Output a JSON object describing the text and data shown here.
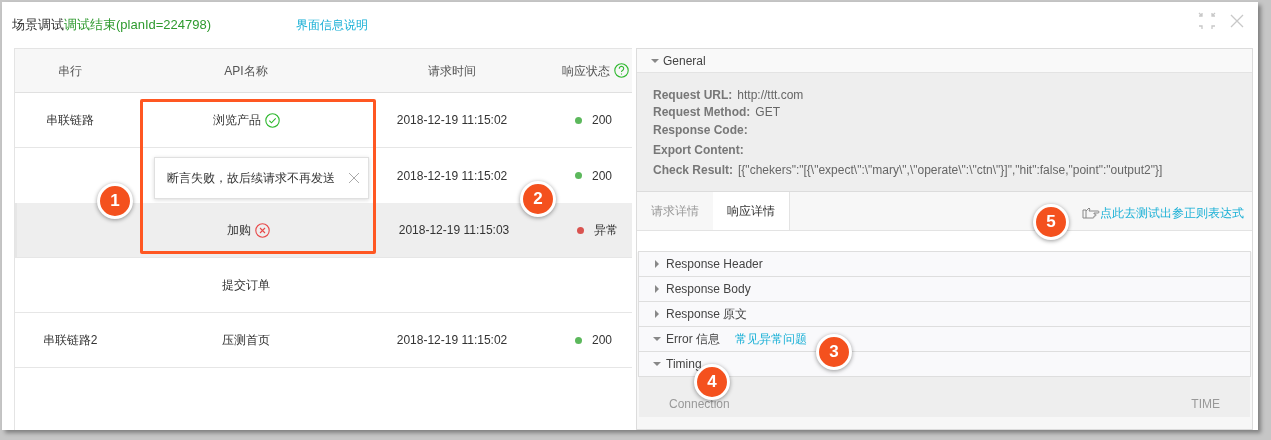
{
  "window": {
    "title": "场景调试",
    "run_status": "调试结束(planId=224798)",
    "info_link": "界面信息说明"
  },
  "table": {
    "columns": [
      "串行",
      "API名称",
      "请求时间",
      "响应状态"
    ],
    "rows": [
      {
        "chain": "串联链路",
        "api": "浏览产品",
        "passed": true,
        "time": "2018-12-19 11:15:02",
        "status": "200",
        "color": "#5cb85c",
        "selected": false
      },
      {
        "chain": "",
        "api": "",
        "time": "2018-12-19 11:15:02",
        "status": "200",
        "color": "#5cb85c",
        "selected": false
      },
      {
        "chain": "",
        "api": "加购",
        "passed": false,
        "time": "2018-12-19 11:15:03",
        "status": "异常",
        "color": "#d9534f",
        "selected": true
      },
      {
        "chain": "",
        "api": "提交订单",
        "time": "",
        "status": "",
        "color": "",
        "selected": false
      },
      {
        "chain": "串联链路2",
        "api": "压测首页",
        "time": "2018-12-19 11:15:02",
        "status": "200",
        "color": "#5cb85c",
        "selected": false
      }
    ]
  },
  "tooltip": {
    "text": "断言失败，故后续请求不再发送"
  },
  "general": {
    "title": "General",
    "expanded": true,
    "fields": [
      {
        "label": "Request URL:",
        "value": "http://ttt.com"
      },
      {
        "label": "Request Method:",
        "value": "GET"
      },
      {
        "label": "Response Code:"
      },
      {
        "label": "Export Content:"
      },
      {
        "label": "Check Result:",
        "value": "[{\"chekers\":\"[{\\\"expect\\\":\\\"mary\\\",\\\"operate\\\":\\\"ctn\\\"}]\",\"hit\":false,\"point\":\"output2\"}]"
      }
    ]
  },
  "tabs": [
    {
      "label": "请求详情",
      "selected": false
    },
    {
      "label": "响应详情",
      "selected": true
    }
  ],
  "regex_link": "点此去测试出参正则表达式",
  "sections": [
    {
      "title": "Response Header",
      "expanded": false
    },
    {
      "title": "Response Body",
      "expanded": false
    },
    {
      "title": "Response 原文",
      "expanded": false
    },
    {
      "title": "Error 信息",
      "expanded": true,
      "link": "常见异常问题"
    },
    {
      "title": "Timing",
      "expanded": true
    }
  ],
  "timing": {
    "columns": [
      "Connection",
      "TIME"
    ]
  },
  "callouts": [
    "1",
    "2",
    "3",
    "4",
    "5"
  ]
}
